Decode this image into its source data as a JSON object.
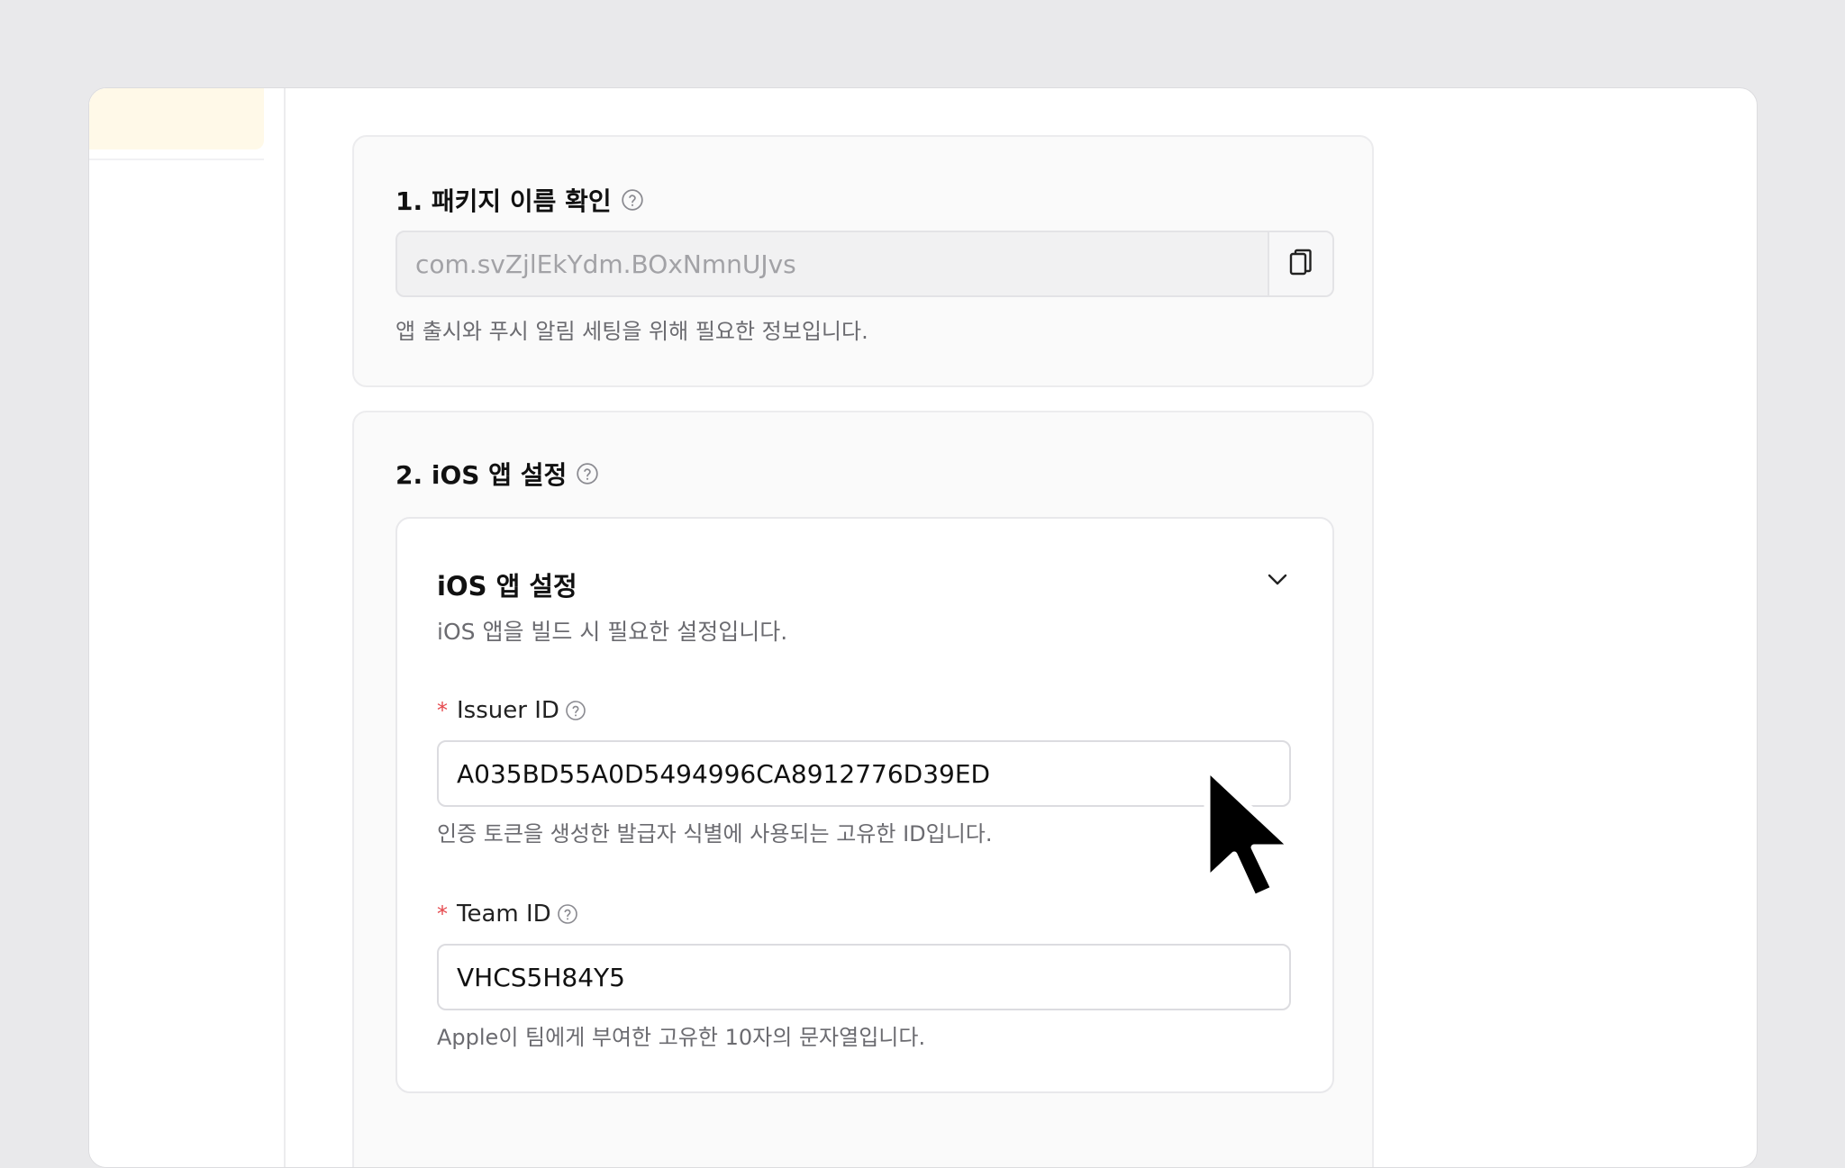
{
  "section1": {
    "title": "1. 패키지 이름 확인",
    "package_name": "com.svZjlEkYdm.BOxNmnUJvs",
    "helper": "앱 출시와 푸시 알림 세팅을 위해 필요한 정보입니다."
  },
  "section2": {
    "title": "2. iOS 앱 설정",
    "card": {
      "title": "iOS 앱 설정",
      "description": "iOS 앱을 빌드 시 필요한 설정입니다.",
      "issuer": {
        "required_mark": "*",
        "label": "Issuer ID",
        "value": "A035BD55A0D5494996CA8912776D39ED",
        "helper": "인증 토큰을 생성한 발급자 식별에 사용되는 고유한 ID입니다."
      },
      "team": {
        "required_mark": "*",
        "label": "Team ID",
        "value": "VHCS5H84Y5",
        "helper": "Apple이 팀에게 부여한 고유한 10자의 문자열입니다."
      }
    }
  },
  "colors": {
    "background": "#e9e9eb",
    "sidebar_active": "#fff9e8",
    "required": "#e5484d",
    "muted_text": "#6b6b70"
  },
  "icons": {
    "help": "question-circle-icon",
    "copy": "copy-icon",
    "chevron": "chevron-down-icon",
    "cursor": "mouse-pointer-icon"
  }
}
